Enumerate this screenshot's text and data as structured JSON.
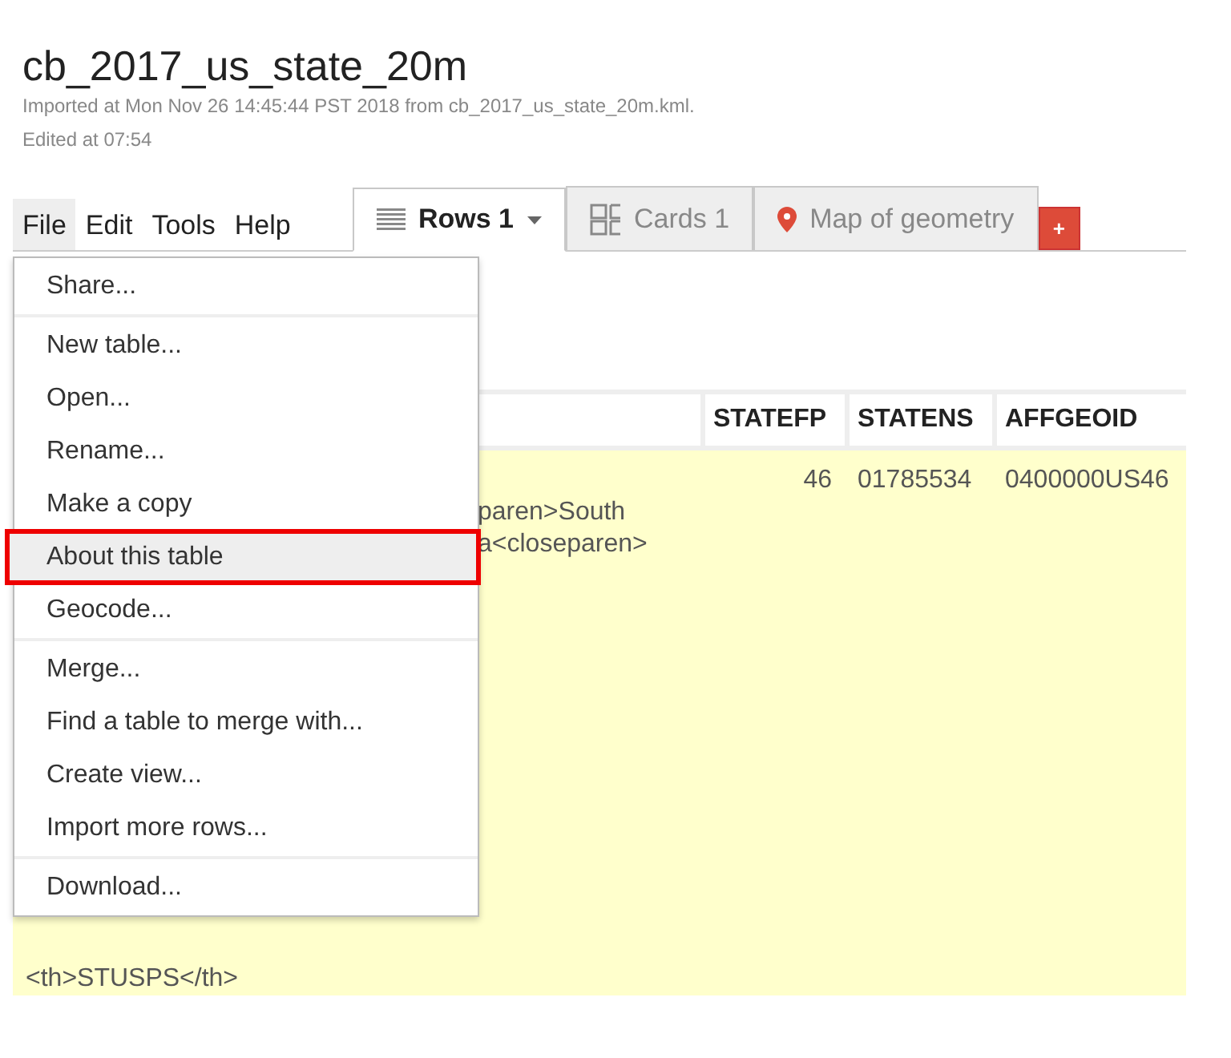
{
  "title": "cb_2017_us_state_20m",
  "subtitle_lines": [
    "Imported at Mon Nov 26 14:45:44 PST 2018 from cb_2017_us_state_20m.kml.",
    "Edited at 07:54"
  ],
  "menubar": [
    {
      "label": "File",
      "selected": true
    },
    {
      "label": "Edit",
      "selected": false
    },
    {
      "label": "Tools",
      "selected": false
    },
    {
      "label": "Help",
      "selected": false
    }
  ],
  "tabs": [
    {
      "label": "Rows 1",
      "kind": "rows",
      "selected": true
    },
    {
      "label": "Cards 1",
      "kind": "cards",
      "selected": false
    },
    {
      "label": "Map of geometry",
      "kind": "map",
      "selected": false
    }
  ],
  "add_tab": "+",
  "file_menu": [
    [
      {
        "label": "Share...",
        "selected": false
      }
    ],
    [
      {
        "label": "New table...",
        "selected": false
      },
      {
        "label": "Open...",
        "selected": false
      },
      {
        "label": "Rename...",
        "selected": false
      },
      {
        "label": "Make a copy",
        "selected": false
      },
      {
        "label": "About this table",
        "selected": true
      },
      {
        "label": "Geocode...",
        "selected": false
      }
    ],
    [
      {
        "label": "Merge...",
        "selected": false
      },
      {
        "label": "Find a table to merge with...",
        "selected": false
      },
      {
        "label": "Create view...",
        "selected": false
      },
      {
        "label": "Import more rows...",
        "selected": false
      }
    ],
    [
      {
        "label": "Download...",
        "selected": false
      }
    ]
  ],
  "table": {
    "columns": [
      "STATEFP",
      "STATENS",
      "AFFGEOID"
    ],
    "row": {
      "column_1_top": [
        "paren>South",
        "a<closeparen>"
      ],
      "column_1_bottom": [
        "<th>STUSPS</th>"
      ],
      "cells": [
        "46",
        "01785534",
        "0400000US46"
      ]
    }
  }
}
